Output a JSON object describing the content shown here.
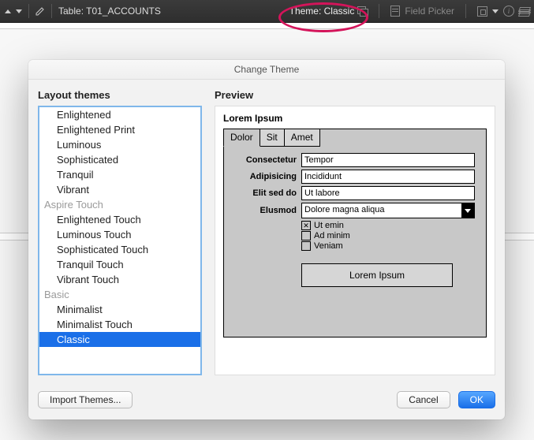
{
  "toolbar": {
    "table_label": "Table: T01_ACCOUNTS",
    "theme_label": "Theme: Classic",
    "field_picker_label": "Field Picker"
  },
  "dialog": {
    "title": "Change Theme",
    "layout_themes_label": "Layout themes",
    "preview_label": "Preview",
    "groups": [
      {
        "name": "",
        "items": [
          "Enlightened",
          "Enlightened Print",
          "Luminous",
          "Sophisticated",
          "Tranquil",
          "Vibrant"
        ]
      },
      {
        "name": "Aspire Touch",
        "items": [
          "Enlightened Touch",
          "Luminous Touch",
          "Sophisticated Touch",
          "Tranquil Touch",
          "Vibrant Touch"
        ]
      },
      {
        "name": "Basic",
        "items": [
          "Minimalist",
          "Minimalist Touch",
          "Classic"
        ]
      }
    ],
    "selected_theme": "Classic",
    "import_label": "Import Themes...",
    "cancel_label": "Cancel",
    "ok_label": "OK"
  },
  "preview": {
    "heading": "Lorem Ipsum",
    "tabs": [
      "Dolor",
      "Sit",
      "Amet"
    ],
    "active_tab": "Dolor",
    "fields": {
      "consectetur": {
        "label": "Consectetur",
        "value": "Tempor"
      },
      "adipisicing": {
        "label": "Adipisicing",
        "value": "Incididunt"
      },
      "elitseddo": {
        "label": "Elit sed do",
        "value": "Ut labore"
      },
      "elusmod": {
        "label": "Elusmod",
        "value": "Dolore magna aliqua"
      }
    },
    "checks": [
      {
        "label": "Ut emin",
        "checked": true
      },
      {
        "label": "Ad minim",
        "checked": false
      },
      {
        "label": "Veniam",
        "checked": false
      }
    ],
    "button_label": "Lorem Ipsum"
  }
}
